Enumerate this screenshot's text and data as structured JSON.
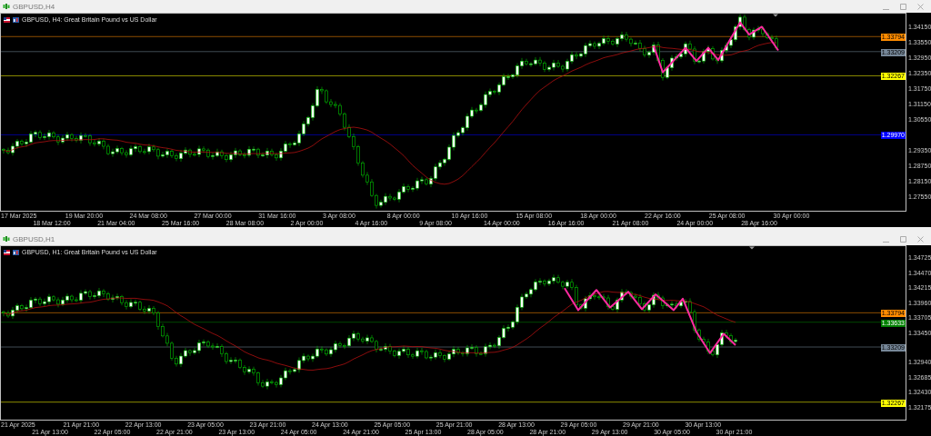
{
  "windows": [
    {
      "title": "GBPUSD,H4",
      "chart_title": "GBPUSD, H4:  Great Britain Pound vs US Dollar",
      "price_ticks": [
        "1.34150",
        "1.33550",
        "1.32950",
        "1.32350",
        "1.31750",
        "1.31150",
        "1.30550",
        "1.29350",
        "1.28750",
        "1.28150",
        "1.27550"
      ],
      "levels": [
        {
          "price": "1.33794",
          "color": "#ff8c00"
        },
        {
          "price": "1.33209",
          "color": "#778899"
        },
        {
          "price": "1.32267",
          "color": "#ffff00"
        },
        {
          "price": "1.29970",
          "color": "#0000ff"
        }
      ],
      "time_labels": [
        "17 Mar 2025",
        "18 Mar 12:00",
        "19 Mar 20:00",
        "21 Mar 04:00",
        "24 Mar 08:00",
        "25 Mar 16:00",
        "27 Mar 00:00",
        "28 Mar 08:00",
        "31 Mar 16:00",
        "2 Apr 00:00",
        "3 Apr 08:00",
        "4 Apr 16:00",
        "8 Apr 00:00",
        "9 Apr 08:00",
        "10 Apr 16:00",
        "14 Apr 00:00",
        "15 Apr 08:00",
        "16 Apr 16:00",
        "18 Apr 00:00",
        "21 Apr 08:00",
        "22 Apr 16:00",
        "24 Apr 00:00",
        "25 Apr 08:00",
        "28 Apr 16:00",
        "30 Apr 00:00"
      ]
    },
    {
      "title": "GBPUSD,H1",
      "chart_title": "GBPUSD, H1:  Great Britain Pound vs US Dollar",
      "price_ticks": [
        "1.34725",
        "1.34470",
        "1.34215",
        "1.33960",
        "1.33705",
        "1.33450",
        "1.32940",
        "1.32685",
        "1.32430",
        "1.32175"
      ],
      "levels": [
        {
          "price": "1.33794",
          "color": "#ff8c00"
        },
        {
          "price": "1.33633",
          "color": "#008000"
        },
        {
          "price": "1.33209",
          "color": "#778899"
        },
        {
          "price": "1.32267",
          "color": "#ffff00"
        }
      ],
      "time_labels": [
        "21 Apr 2025",
        "21 Apr 13:00",
        "21 Apr 21:00",
        "22 Apr 05:00",
        "22 Apr 13:00",
        "22 Apr 21:00",
        "23 Apr 05:00",
        "23 Apr 13:00",
        "23 Apr 21:00",
        "24 Apr 05:00",
        "24 Apr 13:00",
        "24 Apr 21:00",
        "25 Apr 05:00",
        "25 Apr 13:00",
        "25 Apr 21:00",
        "28 Apr 05:00",
        "28 Apr 13:00",
        "28 Apr 21:00",
        "29 Apr 05:00",
        "29 Apr 13:00",
        "29 Apr 21:00",
        "30 Apr 05:00",
        "30 Apr 13:00",
        "30 Apr 21:00"
      ]
    }
  ]
}
